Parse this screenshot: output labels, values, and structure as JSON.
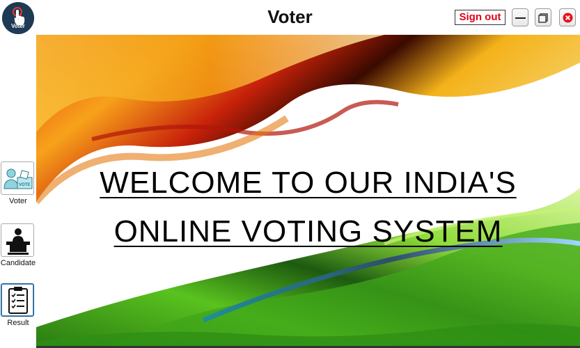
{
  "window": {
    "title": "Voter",
    "logo_text": "Voter",
    "signout_label": "Sign out"
  },
  "sidebar": {
    "items": [
      {
        "label": "Voter",
        "icon": "voter-ballot-icon"
      },
      {
        "label": "Candidate",
        "icon": "candidate-podium-icon"
      },
      {
        "label": "Result",
        "icon": "clipboard-checklist-icon"
      }
    ]
  },
  "banner": {
    "line1": "WELCOME TO OUR INDIA'S",
    "line2": "ONLINE VOTING SYSTEM"
  },
  "colors": {
    "saffron": "#f7a21b",
    "red_orange": "#e2380f",
    "green": "#3fa61a",
    "close_red": "#e8101a",
    "signout_red": "#e0001b"
  }
}
